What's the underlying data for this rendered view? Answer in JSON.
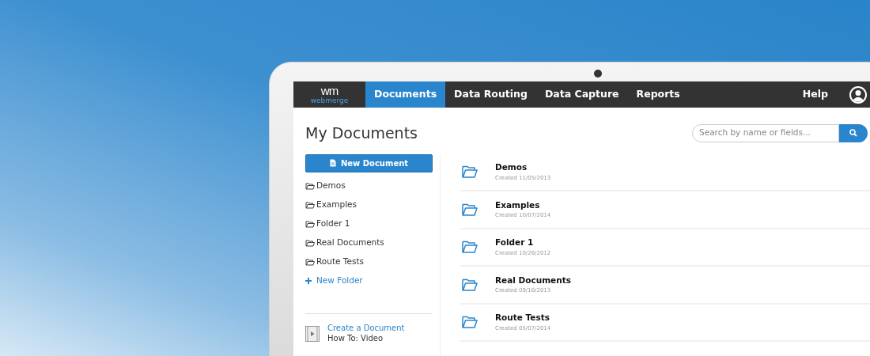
{
  "logo": {
    "mark": "wm",
    "wordmark": "webmerge"
  },
  "nav": {
    "tabs": [
      {
        "label": "Documents",
        "selected": true
      },
      {
        "label": "Data Routing",
        "selected": false
      },
      {
        "label": "Data Capture",
        "selected": false
      },
      {
        "label": "Reports",
        "selected": false
      }
    ],
    "help": "Help"
  },
  "page_title": "My Documents",
  "search": {
    "placeholder": "Search by name or fields..."
  },
  "sidebar": {
    "new_document": "New Document",
    "folders": [
      "Demos",
      "Examples",
      "Folder 1",
      "Real Documents",
      "Route Tests"
    ],
    "new_folder": "New Folder",
    "video": {
      "link": "Create a Document",
      "caption": "How To: Video"
    }
  },
  "documents": [
    {
      "name": "Demos",
      "created": "Created 11/05/2013"
    },
    {
      "name": "Examples",
      "created": "Created 10/07/2014"
    },
    {
      "name": "Folder 1",
      "created": "Created 10/26/2012"
    },
    {
      "name": "Real Documents",
      "created": "Created 09/16/2013"
    },
    {
      "name": "Route Tests",
      "created": "Created 05/07/2014"
    }
  ]
}
